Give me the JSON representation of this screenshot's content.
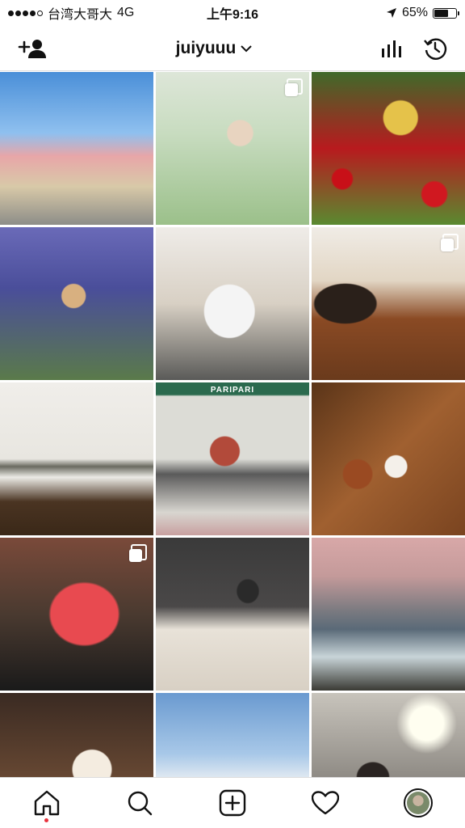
{
  "status_bar": {
    "carrier": "台湾大哥大",
    "network": "4G",
    "time": "上午9:16",
    "battery_text": "65%",
    "battery_level": 0.65,
    "signal_bars_filled": 4,
    "signal_bars_total": 5
  },
  "header": {
    "username": "juiyuuu",
    "add_user_icon": "add-person-icon",
    "insights_icon": "bar-chart-icon",
    "archive_icon": "history-icon"
  },
  "grid": {
    "posts": [
      {
        "subject": "ferris-wheel-street",
        "multiple": false
      },
      {
        "subject": "flower-field-dog",
        "multiple": true
      },
      {
        "subject": "tulip-field-dog",
        "multiple": false
      },
      {
        "subject": "lavender-field-dog",
        "multiple": false
      },
      {
        "subject": "husky-standing",
        "multiple": false
      },
      {
        "subject": "cafe-woman",
        "multiple": true
      },
      {
        "subject": "bar-counter",
        "multiple": false
      },
      {
        "subject": "paripari-storefront",
        "multiple": false
      },
      {
        "subject": "coffee-table",
        "multiple": false
      },
      {
        "subject": "strawberry-dessert",
        "multiple": true
      },
      {
        "subject": "bed-lights",
        "multiple": false
      },
      {
        "subject": "sunset-sea",
        "multiple": false
      },
      {
        "subject": "cafe-dessert",
        "multiple": false
      },
      {
        "subject": "snow-hill",
        "multiple": false
      },
      {
        "subject": "lamp-room",
        "multiple": false
      }
    ],
    "storefront_sign": "PARIPARI"
  },
  "tab_bar": {
    "items": [
      "home-icon",
      "search-icon",
      "new-post-icon",
      "activity-icon",
      "profile-avatar"
    ],
    "active": "home",
    "accent_color": "#e8333d"
  }
}
